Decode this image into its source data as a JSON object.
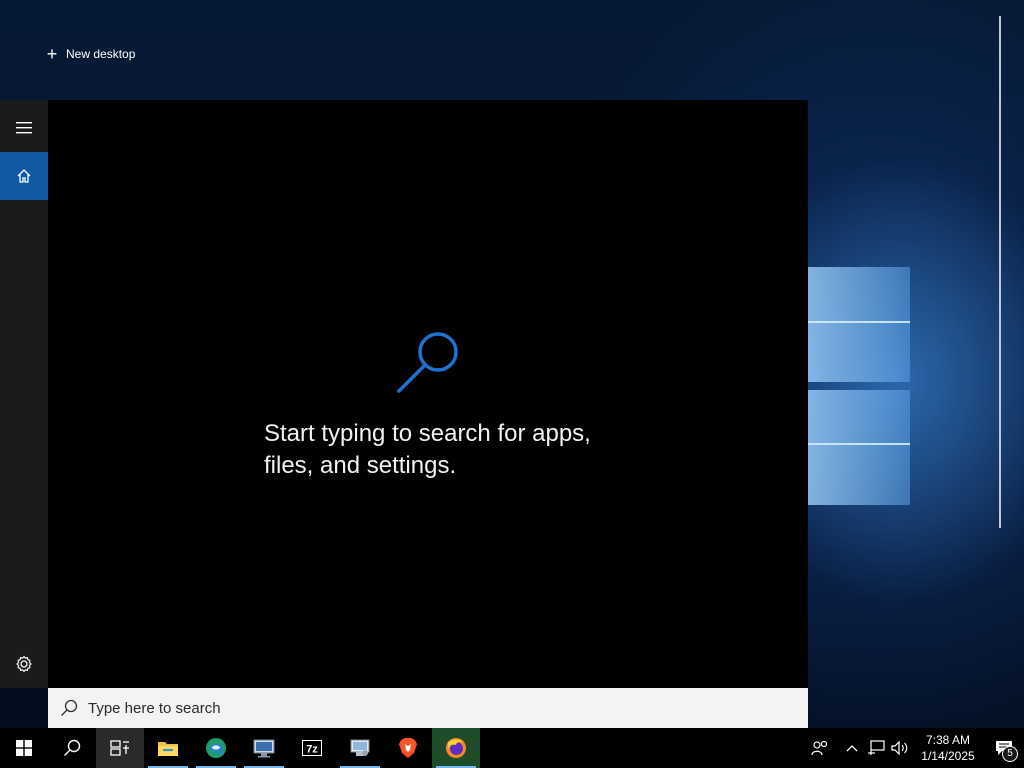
{
  "desktop": {
    "new_desktop_label": "New desktop"
  },
  "start": {
    "menu_icon": "hamburger-icon",
    "home_icon": "home-icon",
    "settings_icon": "gear-icon"
  },
  "search": {
    "hint_line1": "Start typing to search for apps,",
    "hint_line2": "files, and settings.",
    "placeholder": "Type here to search"
  },
  "taskbar": {
    "pinned": [
      {
        "name": "start-button",
        "icon": "windows-icon"
      },
      {
        "name": "search-button",
        "icon": "search-icon"
      },
      {
        "name": "task-view-button",
        "icon": "task-view-icon"
      },
      {
        "name": "file-explorer",
        "icon": "folder-icon"
      },
      {
        "name": "edge",
        "icon": "edge-icon"
      },
      {
        "name": "network-app",
        "icon": "monitor-icon"
      },
      {
        "name": "7zip",
        "icon": "7zip-icon",
        "label": "7z"
      },
      {
        "name": "control-panel",
        "icon": "control-panel-icon"
      },
      {
        "name": "brave",
        "icon": "brave-icon"
      },
      {
        "name": "firefox",
        "icon": "firefox-icon"
      }
    ],
    "clock": {
      "time": "7:38 AM",
      "date": "1/14/2025"
    },
    "notifications_count": "5"
  },
  "colors": {
    "accent": "#0f5aa3",
    "hint_icon": "#1e73d2",
    "taskbar": "#000000"
  }
}
